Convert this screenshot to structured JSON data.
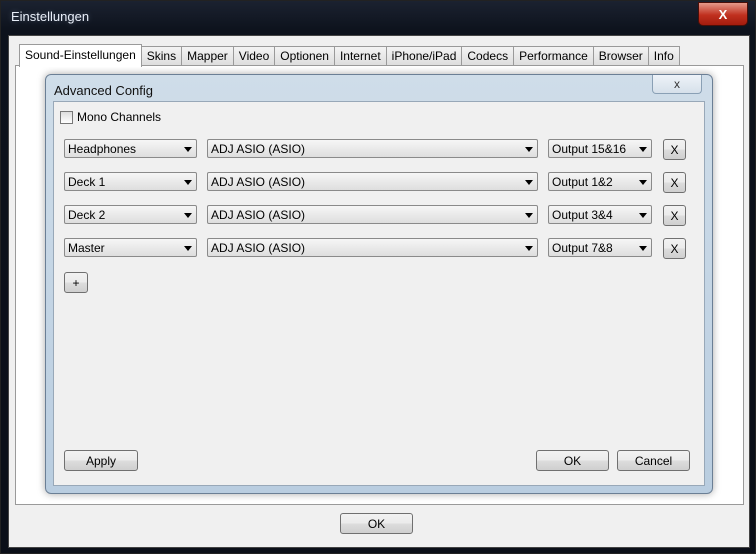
{
  "window": {
    "title": "Einstellungen",
    "close_label": "X"
  },
  "tabs": [
    {
      "label": "Sound-Einstellungen",
      "active": true
    },
    {
      "label": "Skins"
    },
    {
      "label": "Mapper"
    },
    {
      "label": "Video"
    },
    {
      "label": "Optionen"
    },
    {
      "label": "Internet"
    },
    {
      "label": "iPhone/iPad"
    },
    {
      "label": "Codecs"
    },
    {
      "label": "Performance"
    },
    {
      "label": "Browser"
    },
    {
      "label": "Info"
    }
  ],
  "advanced": {
    "title": "Advanced Config",
    "close_label": "x",
    "mono_label": "Mono Channels",
    "mono_checked": false,
    "rows": [
      {
        "channel": "Headphones",
        "device": "ADJ ASIO (ASIO)",
        "output": "Output 15&16",
        "remove": "X"
      },
      {
        "channel": "Deck 1",
        "device": "ADJ ASIO (ASIO)",
        "output": "Output 1&2",
        "remove": "X"
      },
      {
        "channel": "Deck 2",
        "device": "ADJ ASIO (ASIO)",
        "output": "Output 3&4",
        "remove": "X"
      },
      {
        "channel": "Master",
        "device": "ADJ ASIO (ASIO)",
        "output": "Output 7&8",
        "remove": "X"
      }
    ],
    "add_label": "+",
    "apply_label": "Apply",
    "ok_label": "OK",
    "cancel_label": "Cancel"
  },
  "footer": {
    "ok_label": "OK"
  }
}
